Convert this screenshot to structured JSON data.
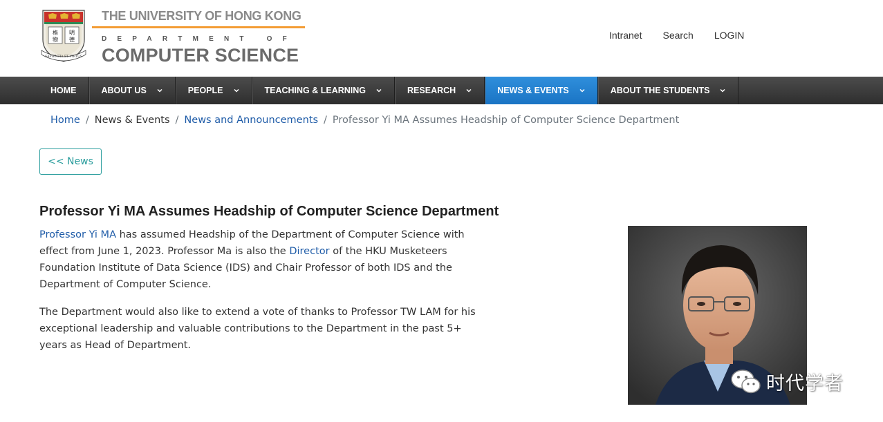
{
  "header": {
    "university_name": "THE UNIVERSITY OF HONG KONG",
    "department_of": "DEPARTMENT OF",
    "department_name": "COMPUTER SCIENCE",
    "crest_motto": "SAPIENTIA ET VIRTUS",
    "crest_chars": [
      "明",
      "德",
      "格",
      "物"
    ],
    "top_links": [
      "Intranet",
      "Search",
      "LOGIN"
    ]
  },
  "nav": {
    "items": [
      {
        "label": "HOME",
        "dropdown": false
      },
      {
        "label": "ABOUT US",
        "dropdown": true
      },
      {
        "label": "PEOPLE",
        "dropdown": true
      },
      {
        "label": "TEACHING & LEARNING",
        "dropdown": true
      },
      {
        "label": "RESEARCH",
        "dropdown": true
      },
      {
        "label": "NEWS & EVENTS",
        "dropdown": true,
        "active": true
      },
      {
        "label": "ABOUT THE STUDENTS",
        "dropdown": true
      }
    ]
  },
  "breadcrumb": {
    "home": "Home",
    "news_events": "News & Events",
    "news_announcements": "News and Announcements",
    "current": "Professor Yi MA Assumes Headship of Computer Science Department",
    "separator": "/"
  },
  "back_button": "<< News",
  "article": {
    "title": "Professor Yi MA Assumes Headship of Computer Science Department",
    "para1_link1": "Professor Yi MA",
    "para1_text1": " has assumed Headship of the Department of Computer Science with effect from June 1, 2023. Professor Ma is also the ",
    "para1_link2": "Director",
    "para1_text2": " of the HKU Musketeers Foundation Institute of Data Science (IDS) and Chair Professor of both IDS and the Department of Computer Science.",
    "para2": "The Department would also like to extend a vote of thanks to Professor TW LAM for his exceptional leadership and valuable contributions to the Department in the past 5+ years as Head of Department."
  },
  "watermark": {
    "text": "时代学者",
    "icon": "wechat-icon"
  },
  "colors": {
    "accent_orange": "#f39c34",
    "nav_dark": "#3a3a3a",
    "nav_active": "#1f7fcf",
    "link_blue": "#1f5ca8",
    "button_teal": "#2a9d9d"
  }
}
